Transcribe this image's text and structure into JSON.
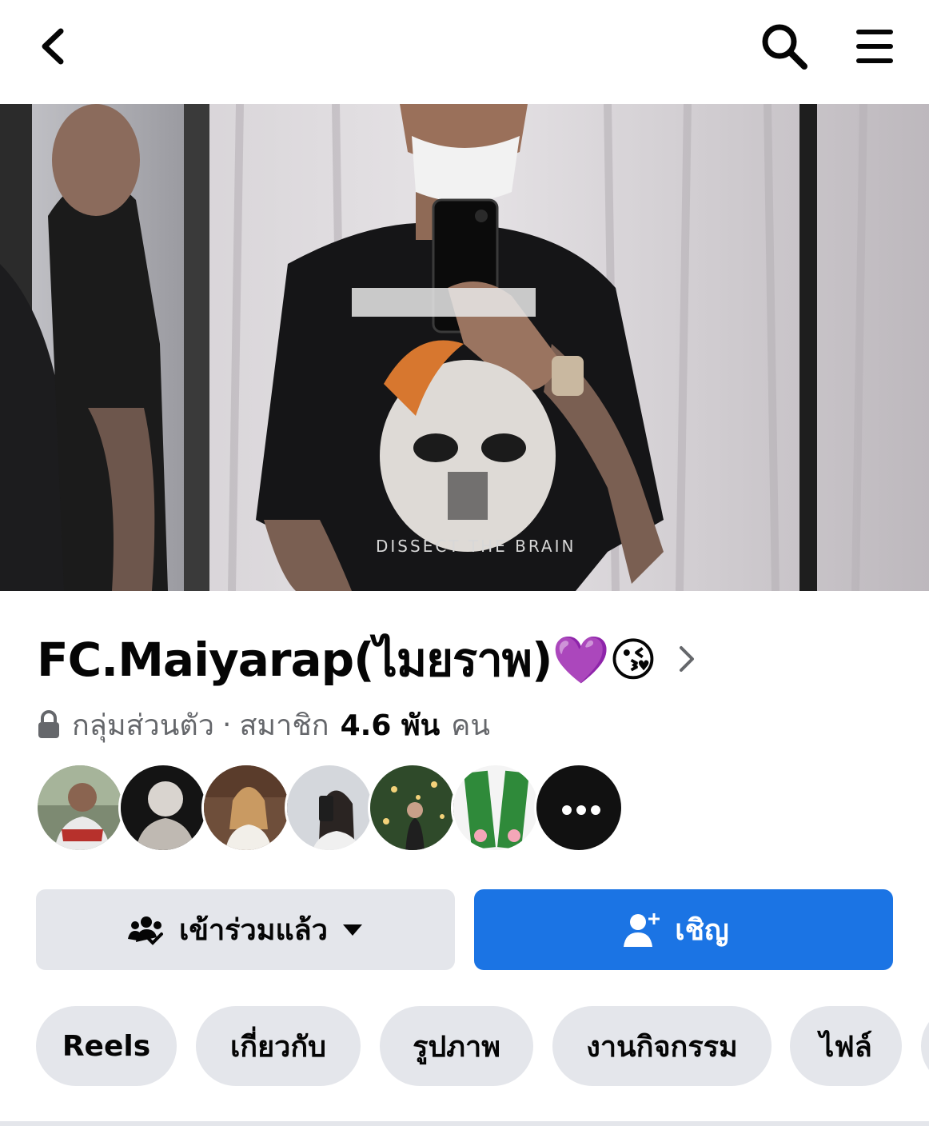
{
  "topbar": {
    "back_icon": "chevron-left-icon",
    "search_icon": "search-icon",
    "menu_icon": "hamburger-menu-icon"
  },
  "cover": {
    "icon": "cover-photo",
    "printed_text": [
      "DISSECT THE BRAIN"
    ]
  },
  "group": {
    "name": "FC.Maiyarap(ไมยราพ)💜😘",
    "privacy": "กลุ่มส่วนตัว",
    "separator": "·",
    "members_label": "สมาชิก",
    "member_count": "4.6 พัน",
    "member_unit": "คน"
  },
  "members_preview": [
    {
      "icon": "member-avatar-1"
    },
    {
      "icon": "member-avatar-2"
    },
    {
      "icon": "member-avatar-3"
    },
    {
      "icon": "member-avatar-4"
    },
    {
      "icon": "member-avatar-5"
    },
    {
      "icon": "member-avatar-6"
    },
    {
      "icon": "more-members-icon"
    }
  ],
  "actions": {
    "joined_label": "เข้าร่วมแล้ว",
    "invite_label": "เชิญ"
  },
  "tabs": [
    {
      "label": "Reels"
    },
    {
      "label": "เกี่ยวกับ"
    },
    {
      "label": "รูปภาพ"
    },
    {
      "label": "งานกิจกรรม"
    },
    {
      "label": "ไฟล์"
    }
  ],
  "colors": {
    "primary": "#1b74e4",
    "secondary_bg": "#e4e6eb",
    "text": "#050505",
    "muted_text": "#65676b"
  }
}
